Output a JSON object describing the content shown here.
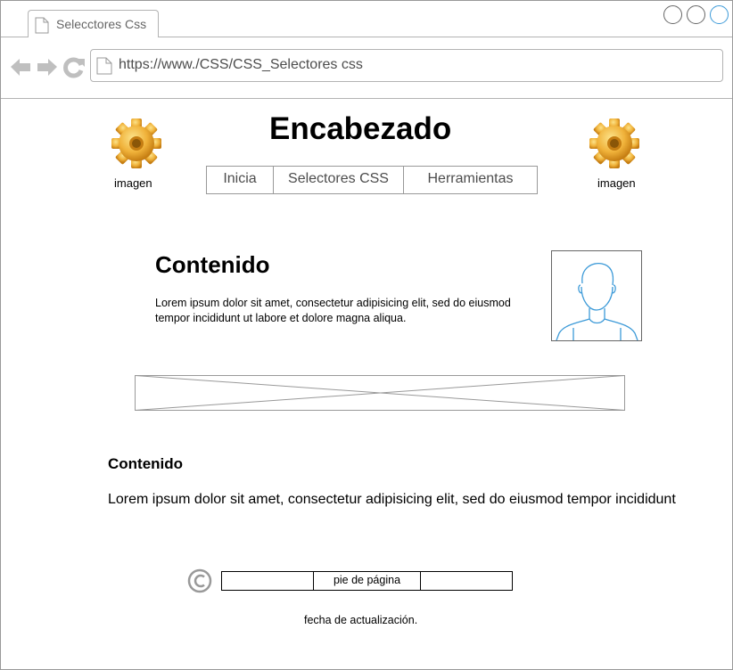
{
  "browser": {
    "tab_title": "Selecctores Css",
    "address_url": "https://www./CSS/CSS_Selectores css"
  },
  "header": {
    "title": "Encabezado",
    "left_image_label": "imagen",
    "right_image_label": "imagen",
    "menu": [
      {
        "label": "Inicia"
      },
      {
        "label": "Selectores CSS"
      },
      {
        "label": "Herramientas"
      }
    ]
  },
  "content": {
    "title": "Contenido",
    "text": "Lorem ipsum dolor sit amet, consectetur adipisicing elit, sed do eiusmod tempor incididunt ut labore et dolore magna aliqua."
  },
  "content2": {
    "title": "Contenido",
    "text": "Lorem ipsum dolor sit amet, consectetur adipisicing elit, sed do eiusmod tempor incididunt"
  },
  "footer": {
    "cells": [
      "",
      "pie de página",
      ""
    ],
    "updated_label": "fecha de actualización."
  },
  "icons": {
    "back": "arrow-left-icon",
    "forward": "arrow-right-icon",
    "reload": "reload-icon",
    "gear": "gear-icon",
    "avatar": "user-avatar-icon",
    "copyright": "copyright-icon"
  },
  "colors": {
    "gear": "#f0b23a",
    "avatar_line": "#3c9ad8",
    "window_button_active": "#3c9ad8"
  }
}
